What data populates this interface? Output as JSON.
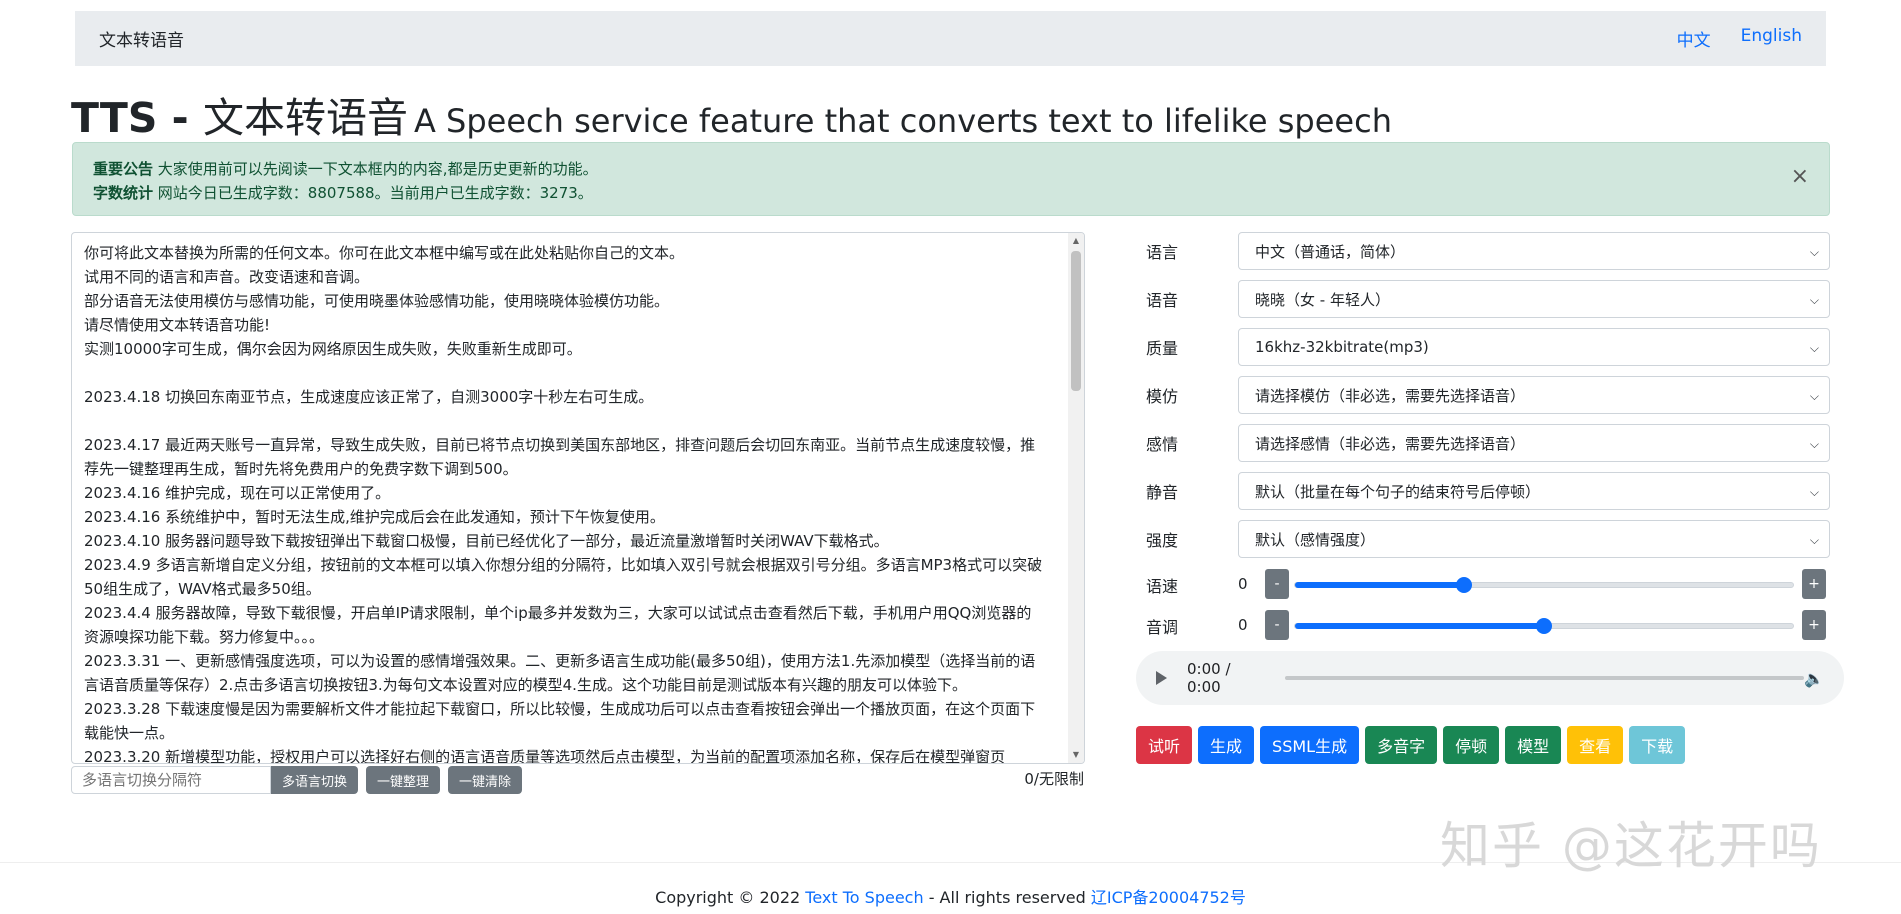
{
  "navbar": {
    "brand": "文本转语音",
    "lang_zh": "中文",
    "lang_en": "English"
  },
  "title": {
    "prefix": "TTS - ",
    "zh": "文本转语音",
    "subtitle": "A Speech service feature that converts text to lifelike speech"
  },
  "alert": {
    "notice_label": "重要公告",
    "notice_text": "大家使用前可以先阅读一下文本框内的内容,都是历史更新的功能。",
    "stats_label": "字数统计",
    "stats_text": "网站今日已生成字数：8807588。当前用户已生成字数：3273。",
    "close": "×"
  },
  "textarea": {
    "lines": [
      "你可将此文本替换为所需的任何文本。你可在此文本框中编写或在此处粘贴你自己的文本。",
      "试用不同的语言和声音。改变语速和音调。",
      "部分语音无法使用模仿与感情功能，可使用晓墨体验感情功能，使用晓晓体验模仿功能。",
      "请尽情使用文本转语音功能!",
      "实测10000字可生成，偶尔会因为网络原因生成失败，失败重新生成即可。",
      "",
      "2023.4.18 切换回东南亚节点，生成速度应该正常了，自测3000字十秒左右可生成。",
      "",
      "2023.4.17 最近两天账号一直异常，导致生成失败，目前已将节点切换到美国东部地区，排查问题后会切回东南亚。当前节点生成速度较慢，推荐先一键整理再生成，暂时先将免费用户的免费字数下调到500。",
      "2023.4.16 维护完成，现在可以正常使用了。",
      "2023.4.16 系统维护中，暂时无法生成,维护完成后会在此发通知，预计下午恢复使用。",
      "2023.4.10 服务器问题导致下载按钮弹出下载窗口极慢，目前已经优化了一部分，最近流量激增暂时关闭WAV下载格式。",
      "2023.4.9 多语言新增自定义分组，按钮前的文本框可以填入你想分组的分隔符，比如填入双引号就会根据双引号分组。多语言MP3格式可以突破50组生成了，WAV格式最多50组。",
      "2023.4.4 服务器故障，导致下载很慢，开启单IP请求限制，单个ip最多并发数为三，大家可以试试点击查看然后下载，手机用户用QQ浏览器的资源嗅探功能下载。努力修复中。。。",
      "2023.3.31 一、更新感情强度选项，可以为设置的感情增强效果。二、更新多语言生成功能(最多50组)，使用方法1.先添加模型（选择当前的语言语音质量等保存）2.点击多语言切换按钮3.为每句文本设置对应的模型4.生成。这个功能目前是测试版本有兴趣的朋友可以体验下。",
      "2023.3.28 下载速度慢是因为需要解析文件才能拉起下载窗口，所以比较慢，生成成功后可以点击查看按钮会弹出一个播放页面，在这个页面下载能快一点。",
      "2023.3.20 新增模型功能，授权用户可以选择好右侧的语言语音质量等选项然后点击模型，为当前的配置项添加名称，保存后在模型弹窗页"
    ]
  },
  "bottom_bar": {
    "separator_placeholder": "多语言切换分隔符",
    "multi_lang_button": "多语言切换",
    "tidy_button": "一键整理",
    "clear_button": "一键清除",
    "count": "0/无限制"
  },
  "form": {
    "rows": [
      {
        "label": "语言",
        "value": "中文（普通话，简体）"
      },
      {
        "label": "语音",
        "value": "晓晓（女 - 年轻人）"
      },
      {
        "label": "质量",
        "value": "16khz-32kbitrate(mp3)"
      },
      {
        "label": "模仿",
        "value": "请选择模仿（非必选，需要先选择语音）"
      },
      {
        "label": "感情",
        "value": "请选择感情（非必选，需要先选择语音）"
      },
      {
        "label": "静音",
        "value": "默认（批量在每个句子的结束符号后停顿）"
      },
      {
        "label": "强度",
        "value": "默认（感情强度）"
      }
    ],
    "speed": {
      "label": "语速",
      "value": "0",
      "minus": "-",
      "plus": "+",
      "fill_fraction": 0.34
    },
    "pitch": {
      "label": "音调",
      "value": "0",
      "minus": "-",
      "plus": "+",
      "fill_fraction": 0.5
    }
  },
  "audio": {
    "time": "0:00 / 0:00"
  },
  "actions": [
    {
      "label": "试听",
      "color": "#dc3545"
    },
    {
      "label": "生成",
      "color": "#0d6efd"
    },
    {
      "label": "SSML生成",
      "color": "#0d6efd"
    },
    {
      "label": "多音字",
      "color": "#198754"
    },
    {
      "label": "停顿",
      "color": "#198754"
    },
    {
      "label": "模型",
      "color": "#198754"
    },
    {
      "label": "查看",
      "color": "#ffc107"
    },
    {
      "label": "下载",
      "color": "#6ec6d8"
    }
  ],
  "footer": {
    "copyright": "Copyright © 2022 ",
    "site_link": "Text To Speech",
    "rights": " - All rights reserved ",
    "icp": "辽ICP备20004752号"
  },
  "watermark": "知乎 @这花开吗"
}
